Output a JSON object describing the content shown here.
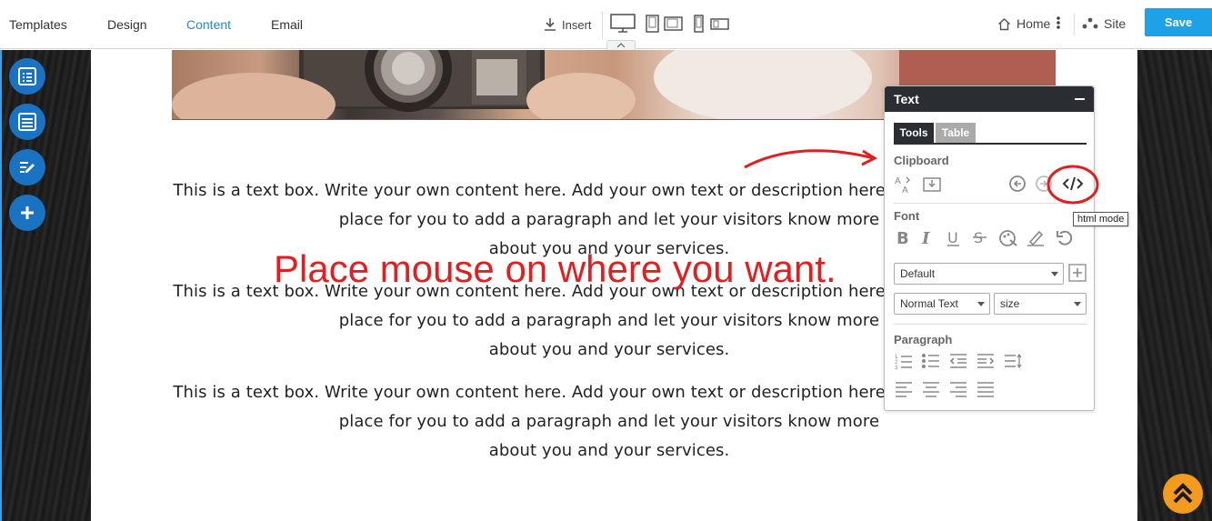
{
  "nav": {
    "tabs": [
      {
        "label": "Templates"
      },
      {
        "label": "Design"
      },
      {
        "label": "Content"
      },
      {
        "label": "Email"
      }
    ],
    "insert_label": "Insert",
    "home_label": "Home",
    "site_label": "Site",
    "save_label": "Save",
    "active_tab": "Content"
  },
  "content": {
    "paragraphs": [
      {
        "lines": [
          "This is a text box. Write your own content here. Add your own text or description here. This is the perfect",
          "place for you to add a paragraph and let your visitors know more",
          "about you and your services."
        ]
      },
      {
        "lines": [
          "This is a text box. Write your own content here. Add your own text or description here. This is the perfect",
          "place for you to add a paragraph and let your visitors know more",
          "about you and your services."
        ]
      },
      {
        "lines": [
          "This is a text box. Write your own content here. Add your own text or description here. This is the perfect",
          "place for you to add a paragraph and let your visitors know more",
          "about you and your services."
        ]
      }
    ],
    "annotation": "Place mouse on where you want."
  },
  "panel": {
    "title": "Text",
    "tabs": [
      {
        "label": "Tools"
      },
      {
        "label": "Table"
      }
    ],
    "sections": {
      "clipboard": "Clipboard",
      "font": "Font",
      "paragraph": "Paragraph"
    },
    "font_family_value": "Default",
    "text_style_value": "Normal Text",
    "size_value": "size",
    "tooltip": "html mode"
  },
  "colors": {
    "accent": "#1e88d2",
    "save": "#1ea1e6",
    "annotation": "#e02020",
    "panel_header": "#2a2d31",
    "scroll_top": "#f29b1f"
  }
}
